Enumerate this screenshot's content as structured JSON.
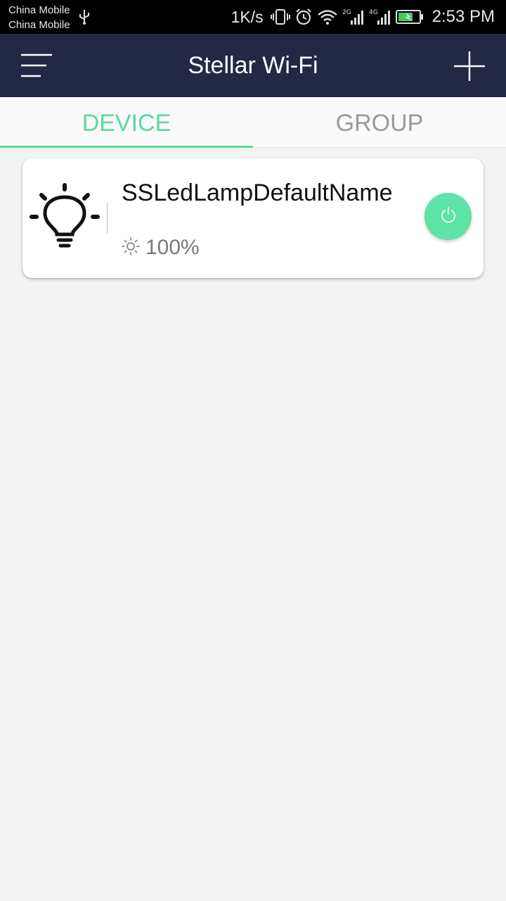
{
  "status_bar": {
    "carrier_1": "China Mobile",
    "carrier_2": "China Mobile",
    "net_speed": "1K/s",
    "sim1_type": "2G",
    "sim2_type": "4G",
    "time": "2:53 PM",
    "icons": [
      "usb-icon",
      "vibrate-icon",
      "alarm-icon",
      "wifi-icon",
      "signal-icon",
      "battery-charging-icon"
    ]
  },
  "app_bar": {
    "title": "Stellar Wi-Fi",
    "background": "#232846",
    "icons": [
      "menu-icon",
      "plus-icon"
    ]
  },
  "tabs": [
    {
      "label": "DEVICE",
      "selected": true
    },
    {
      "label": "GROUP",
      "selected": false
    }
  ],
  "accent_color": "#5cd99b",
  "devices": [
    {
      "name": "SSLedLampDefaultName",
      "brightness": "100%",
      "icon": "light-bulb-icon",
      "power_on": true
    }
  ]
}
